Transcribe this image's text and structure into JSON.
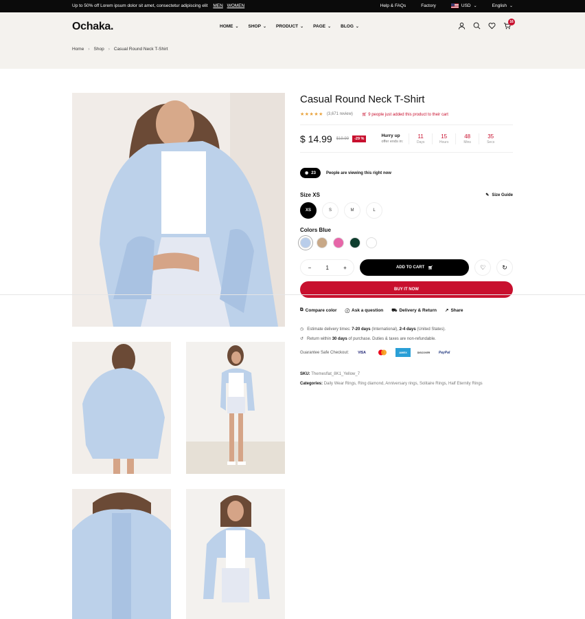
{
  "topbar": {
    "promo": "Up to 50% off Lorem ipsum dolor sit amet, consectetur adipiscing elit",
    "men": "MEN",
    "women": "WOMEN",
    "help": "Help & FAQs",
    "factory": "Factory",
    "currency": "USD",
    "language": "English"
  },
  "header": {
    "logo": "Ochaka.",
    "nav": [
      "HOME",
      "SHOP",
      "PRODUCT",
      "PAGE",
      "BLOG"
    ],
    "cart_count": "16"
  },
  "breadcrumb": [
    "Home",
    "Shop",
    "Casual Round Neck T-Shirt"
  ],
  "product": {
    "title": "Casual Round Neck T-Shirt",
    "stars": "★★★★★",
    "reviews": "(3,671 review)",
    "cart_note": "9 people just added this product to their cart",
    "price": "$ 14.99",
    "old_price": "$19.99",
    "discount": "-29 %",
    "hurry_title": "Hurry up",
    "hurry_sub": "offer ends in:",
    "countdown": [
      {
        "value": "11",
        "unit": "Days"
      },
      {
        "value": "15",
        "unit": "Hours"
      },
      {
        "value": "48",
        "unit": "Mins"
      },
      {
        "value": "35",
        "unit": "Secs"
      }
    ],
    "viewers": "23",
    "viewers_text": "People are viewing this right now",
    "size_label": "Size XS",
    "size_guide": "Size Guide",
    "sizes": [
      "XS",
      "S",
      "M",
      "L"
    ],
    "color_label": "Colors Blue",
    "colors": [
      "#b9cdea",
      "#c8a887",
      "#e666a8",
      "#0e3d2e",
      "#ffffff"
    ],
    "qty": "1",
    "add_to_cart": "ADD TO CART",
    "buy_now": "BUY IT NOW",
    "actions": [
      "Compare color",
      "Ask a question",
      "Delivery & Return",
      "Share"
    ],
    "delivery_pre": "Estimate delivery times:",
    "delivery_intl": "7-20 days",
    "delivery_mid": "(International),",
    "delivery_us": "2-4 days",
    "delivery_post": "(United States).",
    "return_pre": "Return within",
    "return_days": "30 days",
    "return_post": "of purchase. Duties & taxes are non-refundable.",
    "checkout_label": "Guarantee Safe Checkout:",
    "payments": [
      "VISA",
      "MC",
      "AMEX",
      "DISCOVER",
      "PayPal"
    ],
    "sku_label": "SKU:",
    "sku": "Themesflat_8K1_Yellow_7",
    "categories_label": "Categories:",
    "categories": "Daily Wear Rings, Ring diamond, Anniversary rings, Solitaire Rings, Half Eternity Rings"
  }
}
